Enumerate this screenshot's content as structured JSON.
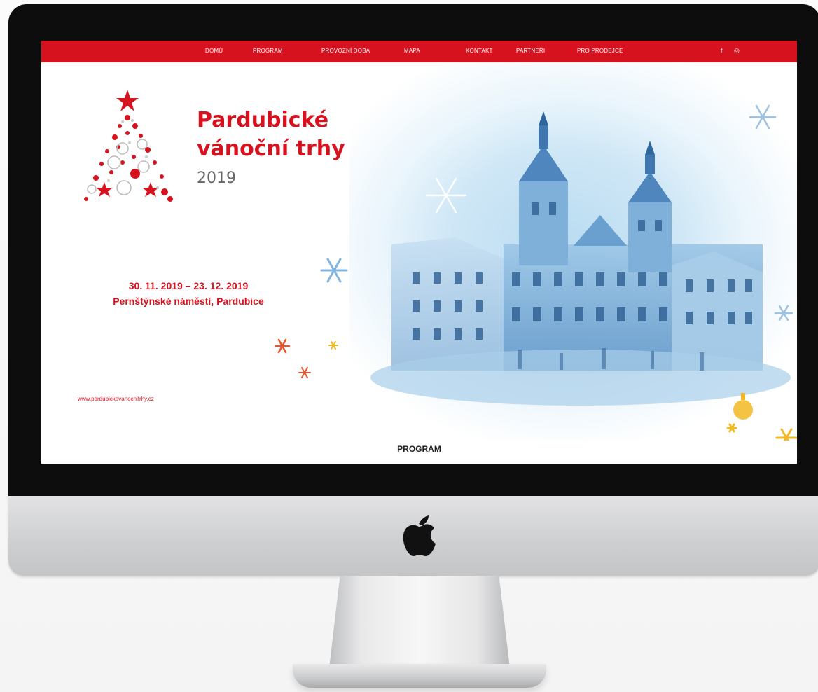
{
  "nav": {
    "items": [
      {
        "id": "domu",
        "label": "DOMŮ"
      },
      {
        "id": "program",
        "label": "PROGRAM"
      },
      {
        "id": "provozni-doba",
        "label": "PROVOZNÍ DOBA"
      },
      {
        "id": "mapa",
        "label": "MAPA"
      },
      {
        "id": "kontakt",
        "label": "KONTAKT"
      },
      {
        "id": "partneri",
        "label": "PARTNEŘI"
      },
      {
        "id": "pro-prodejce",
        "label": "PRO PRODEJCE"
      }
    ],
    "social": {
      "facebook": "f",
      "instagram": "◎"
    }
  },
  "hero": {
    "title_line1": "Pardubické",
    "title_line2": "vánoční trhy",
    "year": "2019",
    "dates": "30. 11. 2019 – 23. 12. 2019",
    "venue": "Pernštýnské náměstí, Pardubice",
    "website": "www.pardubickevanocnitrhy.cz"
  },
  "section": {
    "heading": "PROGRAM"
  },
  "colors": {
    "brand_red": "#d7121f",
    "nav_text": "#ffffff",
    "bezel": "#0d0d0d",
    "watercolor_blue": "#b9dcf1",
    "gold": "#f2b822"
  },
  "icons": {
    "logo": "christmas-tree-icon",
    "device": "apple-logo-icon"
  }
}
